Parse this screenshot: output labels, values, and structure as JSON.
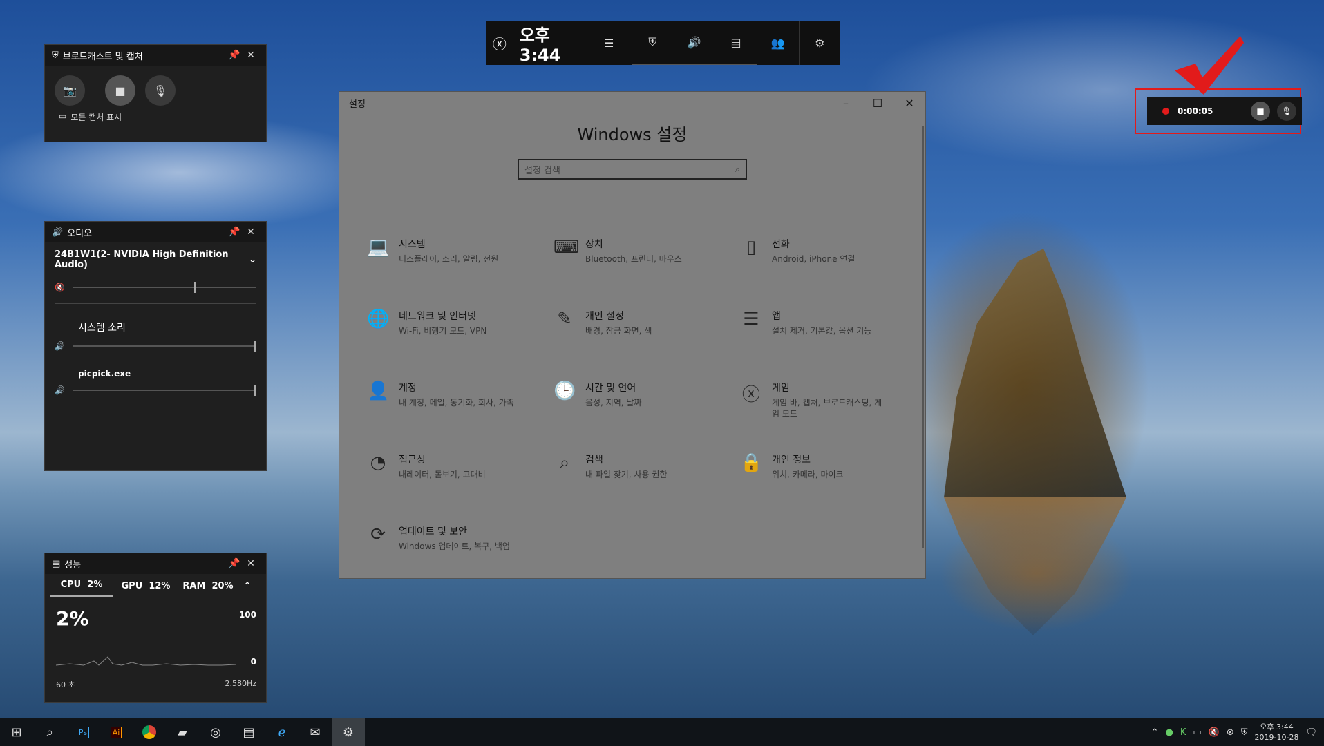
{
  "colors": {
    "accent_red": "#e21b1b",
    "widget_bg": "#1f1f1f",
    "settings_bg": "#7f7f7f"
  },
  "broadcast": {
    "title": "브로드캐스트 및 캡처",
    "show_all": "모든 캡처 표시"
  },
  "audio": {
    "title": "오디오",
    "device": "24B1W1(2- NVIDIA High Definition Audio)",
    "system_sound": "시스템 소리",
    "app": "picpick.exe"
  },
  "performance": {
    "title": "성능",
    "tabs": [
      {
        "label": "CPU",
        "value": "2%"
      },
      {
        "label": "GPU",
        "value": "12%"
      },
      {
        "label": "RAM",
        "value": "20%"
      }
    ],
    "big_value": "2%",
    "max": "100",
    "min": "0",
    "duration": "60 초",
    "freq": "2.580Hz"
  },
  "gamebar": {
    "time": "오후 3:44"
  },
  "settings": {
    "window_title": "설정",
    "heading": "Windows 설정",
    "search_placeholder": "설정 검색",
    "items": [
      {
        "name": "시스템",
        "desc": "디스플레이, 소리, 알림, 전원",
        "icon": "laptop-icon"
      },
      {
        "name": "장치",
        "desc": "Bluetooth, 프린터, 마우스",
        "icon": "devices-icon"
      },
      {
        "name": "전화",
        "desc": "Android, iPhone 연결",
        "icon": "phone-icon"
      },
      {
        "name": "네트워크 및 인터넷",
        "desc": "Wi-Fi, 비행기 모드, VPN",
        "icon": "globe-icon"
      },
      {
        "name": "개인 설정",
        "desc": "배경, 잠금 화면, 색",
        "icon": "personalization-icon"
      },
      {
        "name": "앱",
        "desc": "설치 제거, 기본값, 옵션 기능",
        "icon": "apps-icon"
      },
      {
        "name": "계정",
        "desc": "내 계정, 메일, 동기화, 회사, 가족",
        "icon": "account-icon"
      },
      {
        "name": "시간 및 언어",
        "desc": "음성, 지역, 날짜",
        "icon": "time-language-icon"
      },
      {
        "name": "게임",
        "desc": "게임 바, 캡처, 브로드캐스팅, 게임 모드",
        "icon": "xbox-icon"
      },
      {
        "name": "접근성",
        "desc": "내레이터, 돋보기, 고대비",
        "icon": "accessibility-icon"
      },
      {
        "name": "검색",
        "desc": "내 파일 찾기, 사용 권한",
        "icon": "search-icon"
      },
      {
        "name": "개인 정보",
        "desc": "위치, 카메라, 마이크",
        "icon": "lock-icon"
      },
      {
        "name": "업데이트 및 보안",
        "desc": "Windows 업데이트, 복구, 백업",
        "icon": "refresh-icon"
      }
    ]
  },
  "recording": {
    "timer": "0:00:05"
  },
  "taskbar": {
    "time": "오후 3:44",
    "date": "2019-10-28"
  }
}
